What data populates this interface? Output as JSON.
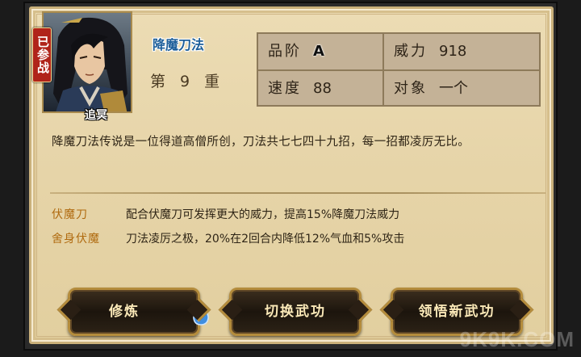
{
  "character": {
    "badge": "已参战",
    "name": "追冥"
  },
  "skill": {
    "name": "降魔刀法",
    "level": "第 9 重"
  },
  "stats": {
    "grade_label": "品阶",
    "grade_value": "A",
    "power_label": "威力",
    "power_value": "918",
    "speed_label": "速度",
    "speed_value": "88",
    "target_label": "对象",
    "target_value": "一个"
  },
  "description": "降魔刀法传说是一位得道高僧所创，刀法共七七四十九招，每一招都凌厉无比。",
  "combos": [
    {
      "name": "伏魔刀",
      "text": "配合伏魔刀可发挥更大的威力，提高15%降魔刀法威力"
    },
    {
      "name": "舍身伏魔",
      "text": "刀法凌厉之极，20%在2回合内降低12%气血和5%攻击"
    }
  ],
  "buttons": {
    "train": "修炼",
    "switch": "切换武功",
    "learn": "领悟新武功"
  },
  "watermark": "9K9K.COM",
  "colors": {
    "skill_name": "#1e5f9a",
    "combo_name": "#b06b10",
    "badge": "#b0241a"
  }
}
